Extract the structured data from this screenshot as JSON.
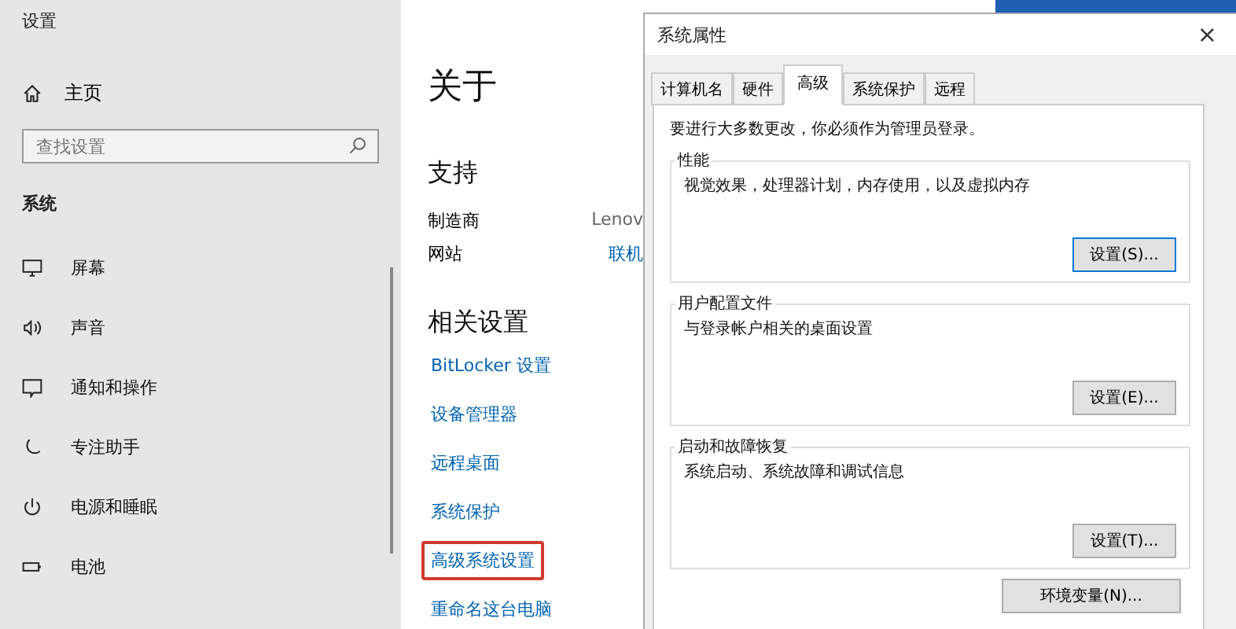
{
  "settings": {
    "title": "设置",
    "home": "主页",
    "search": {
      "placeholder": "查找设置"
    },
    "section": "系统",
    "nav": [
      {
        "label": "屏幕",
        "kind": "monitor"
      },
      {
        "label": "声音",
        "kind": "sound"
      },
      {
        "label": "通知和操作",
        "kind": "notify"
      },
      {
        "label": "专注助手",
        "kind": "moon"
      },
      {
        "label": "电源和睡眠",
        "kind": "power"
      },
      {
        "label": "电池",
        "kind": "battery"
      }
    ],
    "page_title": "关于",
    "support": {
      "heading": "支持",
      "rows": [
        {
          "label": "制造商",
          "value": "Lenov",
          "link": false
        },
        {
          "label": "网站",
          "value": "联机",
          "link": true
        }
      ]
    },
    "related": {
      "heading": "相关设置",
      "links": [
        {
          "label": "BitLocker 设置",
          "highlighted": false
        },
        {
          "label": "设备管理器",
          "highlighted": false
        },
        {
          "label": "远程桌面",
          "highlighted": false
        },
        {
          "label": "系统保护",
          "highlighted": false
        },
        {
          "label": "高级系统设置",
          "highlighted": true
        },
        {
          "label": "重命名这台电脑",
          "highlighted": false
        }
      ]
    }
  },
  "dialog": {
    "title": "系统属性",
    "close": "×",
    "tabs": [
      {
        "label": "计算机名",
        "selected": false
      },
      {
        "label": "硬件",
        "selected": false
      },
      {
        "label": "高级",
        "selected": true
      },
      {
        "label": "系统保护",
        "selected": false
      },
      {
        "label": "远程",
        "selected": false
      }
    ],
    "notice": "要进行大多数更改，你必须作为管理员登录。",
    "groups": [
      {
        "title": "性能",
        "description": "视觉效果，处理器计划，内存使用，以及虚拟内存",
        "button": "设置(S)..."
      },
      {
        "title": "用户配置文件",
        "description": "与登录帐户相关的桌面设置",
        "button": "设置(E)..."
      },
      {
        "title": "启动和故障恢复",
        "description": "系统启动、系统故障和调试信息",
        "button": "设置(T)..."
      }
    ],
    "env_button": "环境变量(N)..."
  }
}
